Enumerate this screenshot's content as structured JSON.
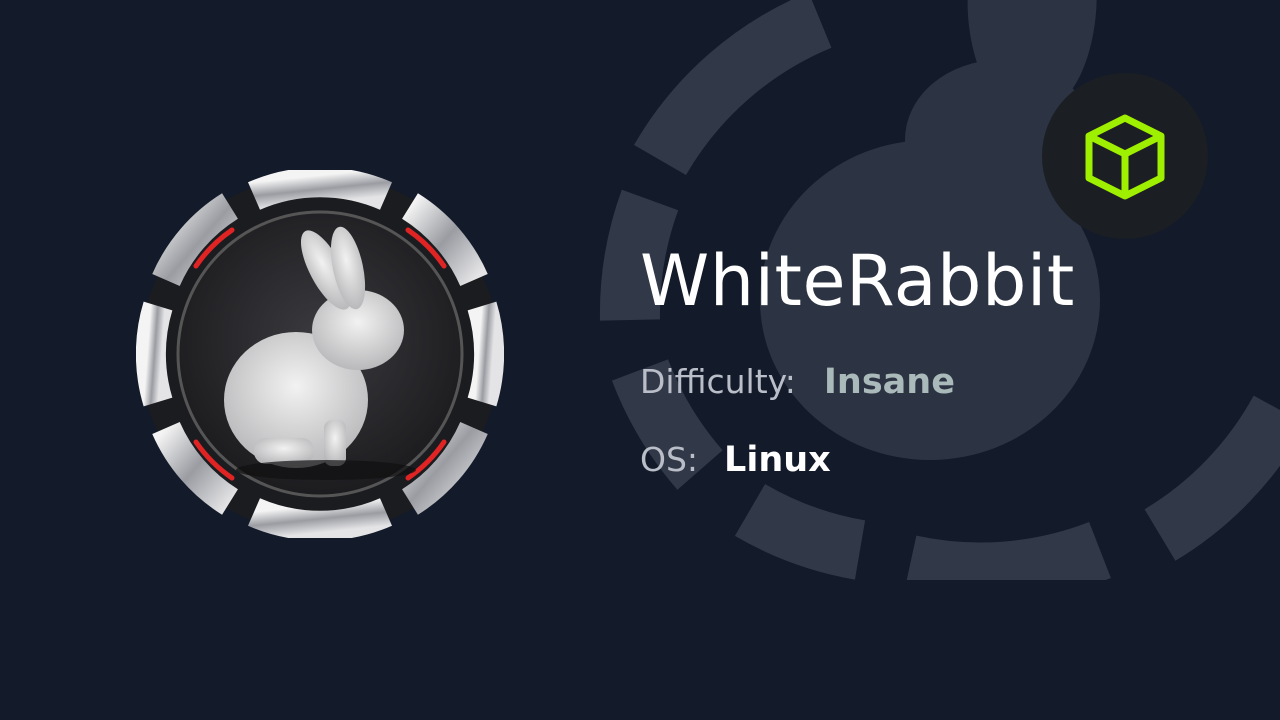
{
  "machine": {
    "name": "WhiteRabbit",
    "difficulty_label": "Difficulty:",
    "difficulty_value": "Insane",
    "os_label": "OS:",
    "os_value": "Linux"
  },
  "icons": {
    "badge": "white-rabbit-icon",
    "brand": "cube-icon"
  },
  "colors": {
    "background": "#131a29",
    "difficulty_accent": "#aab9b9",
    "brand_green": "#9fef00",
    "badge_red": "#e02424"
  }
}
